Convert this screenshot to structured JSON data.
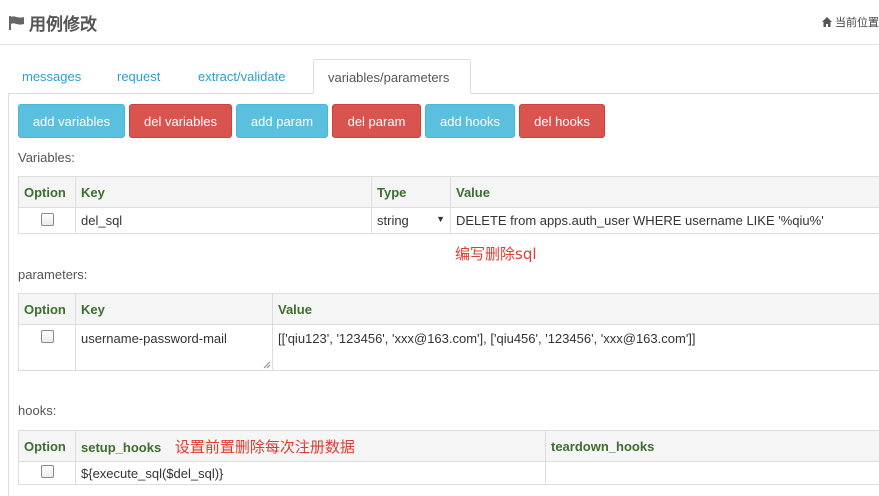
{
  "header": {
    "title": "用例修改",
    "breadcrumb": "当前位置"
  },
  "tabs": [
    {
      "label": "messages"
    },
    {
      "label": "request"
    },
    {
      "label": "extract/validate"
    },
    {
      "label": "variables/parameters",
      "active": true
    }
  ],
  "toolbar": {
    "add_variables": "add variables",
    "del_variables": "del variables",
    "add_param": "add param",
    "del_param": "del param",
    "add_hooks": "add hooks",
    "del_hooks": "del hooks"
  },
  "variables": {
    "label": "Variables:",
    "headers": {
      "option": "Option",
      "key": "Key",
      "type": "Type",
      "value": "Value"
    },
    "rows": [
      {
        "checked": false,
        "key": "del_sql",
        "type": "string",
        "value": "DELETE from apps.auth_user WHERE username LIKE '%qiu%'"
      }
    ],
    "annotation": "编写删除sql"
  },
  "parameters": {
    "label": "parameters:",
    "headers": {
      "option": "Option",
      "key": "Key",
      "value": "Value"
    },
    "rows": [
      {
        "checked": false,
        "key": "username-password-mail",
        "value": "[['qiu123', '123456', 'xxx@163.com'], ['qiu456', '123456', 'xxx@163.com']]"
      }
    ]
  },
  "hooks": {
    "label": "hooks:",
    "headers": {
      "option": "Option",
      "setup": "setup_hooks",
      "teardown": "teardown_hooks"
    },
    "annotation": "设置前置删除每次注册数据",
    "rows": [
      {
        "checked": false,
        "setup": "${execute_sql($del_sql)}",
        "teardown": ""
      }
    ]
  },
  "colors": {
    "info": "#5bc0de",
    "danger": "#d9534f",
    "link": "#2a9fd6",
    "header_text": "#3c6e2e",
    "annotation": "#e03c31"
  }
}
